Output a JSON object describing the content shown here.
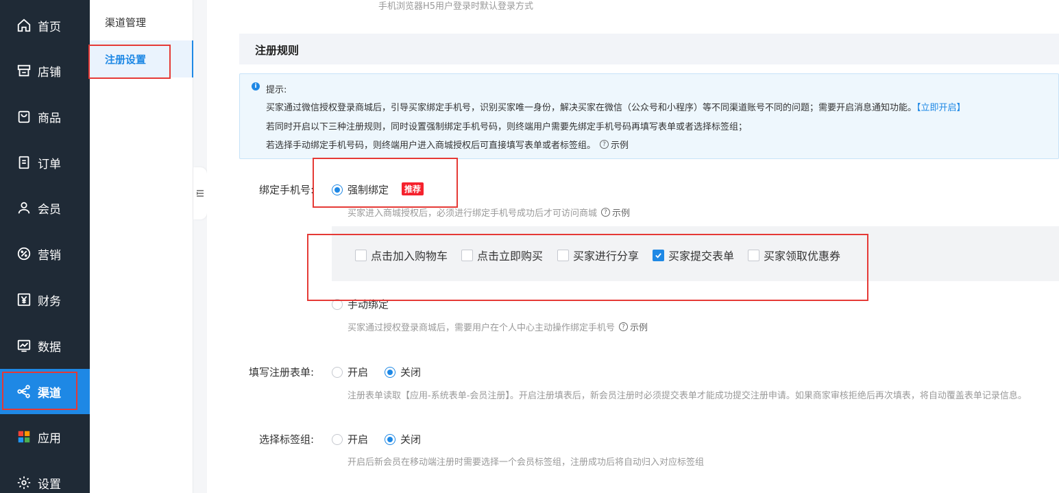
{
  "nav": [
    {
      "label": "首页",
      "icon": "home-icon"
    },
    {
      "label": "店铺",
      "icon": "store-icon"
    },
    {
      "label": "商品",
      "icon": "bag-icon"
    },
    {
      "label": "订单",
      "icon": "order-icon"
    },
    {
      "label": "会员",
      "icon": "user-icon"
    },
    {
      "label": "营销",
      "icon": "discount-icon"
    },
    {
      "label": "财务",
      "icon": "yen-icon"
    },
    {
      "label": "数据",
      "icon": "chart-icon"
    },
    {
      "label": "渠道",
      "icon": "share-icon"
    },
    {
      "label": "应用",
      "icon": "apps-icon"
    },
    {
      "label": "设置",
      "icon": "gear-icon"
    }
  ],
  "subnav": [
    {
      "label": "渠道管理"
    },
    {
      "label": "注册设置"
    }
  ],
  "top_hint": "手机浏览器H5用户登录时默认登录方式",
  "section_title": "注册规则",
  "tip": {
    "title": "提示:",
    "line1": "买家通过微信授权登录商城后，引导买家绑定手机号，识别买家唯一身份，解决买家在微信（公众号和小程序）等不同渠道账号不同的问题；需要开启消息通知功能。",
    "line1_link": "【立即开启】",
    "line2": "若同时开启以下三种注册规则，同时设置强制绑定手机号码，则终端用户需要先绑定手机号码再填写表单或者选择标签组；",
    "line3": "若选择手动绑定手机号码，则终端用户进入商城授权后可直接填写表单或者标签组。",
    "example": "示例"
  },
  "bind_phone": {
    "label": "绑定手机号:",
    "force_label": "强制绑定",
    "recommend_badge": "推荐",
    "force_desc": "买家进入商城授权后，必须进行绑定手机号成功后才可访问商城",
    "manual_label": "手动绑定",
    "manual_desc": "买家通过授权登录商城后，需要用户在个人中心主动操作绑定手机号",
    "example": "示例",
    "triggers": [
      {
        "label": "点击加入购物车",
        "checked": false
      },
      {
        "label": "点击立即购买",
        "checked": false
      },
      {
        "label": "买家进行分享",
        "checked": false
      },
      {
        "label": "买家提交表单",
        "checked": true
      },
      {
        "label": "买家领取优惠券",
        "checked": false
      }
    ]
  },
  "reg_form": {
    "label": "填写注册表单:",
    "on": "开启",
    "off": "关闭",
    "desc": "注册表单读取【应用-系统表单-会员注册】。开启注册填表后，新会员注册时必须提交表单才能成功提交注册申请。如果商家审核拒绝后再次填表，将自动覆盖表单记录信息。"
  },
  "tag_group": {
    "label": "选择标签组:",
    "on": "开启",
    "off": "关闭",
    "desc": "开启后新会员在移动端注册时需要选择一个会员标签组，注册成功后将自动归入对应标签组"
  }
}
